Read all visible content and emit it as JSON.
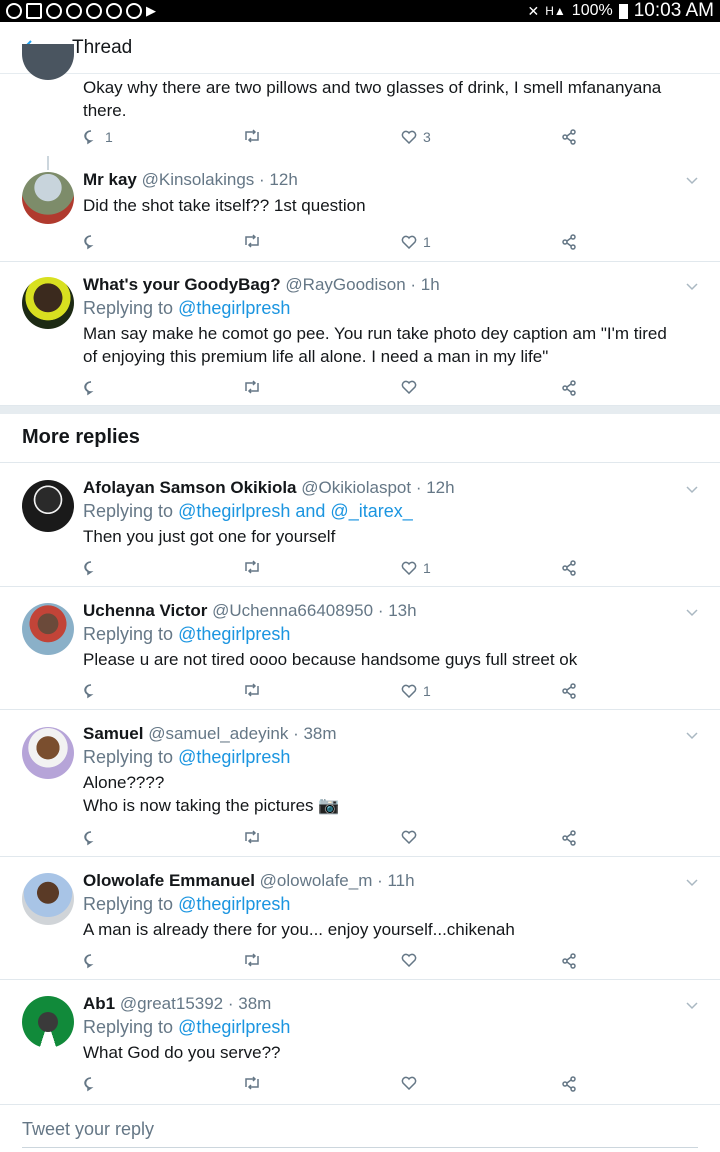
{
  "status_bar": {
    "battery": "100%",
    "time": "10:03 AM"
  },
  "header": {
    "back_icon": "arrow-left-icon",
    "title": "Thread"
  },
  "partial_tweet": {
    "text": "Okay why there are two pillows and two glasses of drink, I smell mfananyana there.",
    "replies": "1",
    "likes": "3"
  },
  "tweets": [
    {
      "name": "Mr kay",
      "handle": "@Kinsolakings",
      "time": "· 12h",
      "reply_prefix": "",
      "reply_to": "",
      "text": "Did the shot take itself?? 1st question",
      "replies": "",
      "likes": "1"
    },
    {
      "name": "What's your GoodyBag?",
      "handle": "@RayGoodison",
      "time": "· 1h",
      "reply_prefix": "Replying to",
      "reply_to": "@thegirlpresh",
      "text": "Man say make he comot go pee. You run take photo dey caption am \"I'm tired of enjoying this premium life all alone. I need a man in my life\"",
      "replies": "",
      "likes": ""
    }
  ],
  "more_replies": {
    "title": "More replies",
    "tweets": [
      {
        "name": "Afolayan Samson Okikiola",
        "handle": "@Okikiolaspot",
        "time": "· 12h",
        "reply_prefix": "Replying to",
        "reply_to": "@thegirlpresh and @_itarex_",
        "text": "Then you just got one for yourself",
        "replies": "",
        "likes": "1"
      },
      {
        "name": "Uchenna Victor",
        "handle": "@Uchenna66408950",
        "time": "· 13h",
        "reply_prefix": "Replying to",
        "reply_to": "@thegirlpresh",
        "text": "Please u are not tired oooo because handsome guys full street ok",
        "replies": "",
        "likes": "1"
      },
      {
        "name": "Samuel",
        "handle": "@samuel_adeyink",
        "time": "· 38m",
        "reply_prefix": "Replying to",
        "reply_to": "@thegirlpresh",
        "text": "Alone????\nWho is now taking the pictures 📷",
        "replies": "",
        "likes": ""
      },
      {
        "name": "Olowolafe Emmanuel",
        "handle": "@olowolafe_m",
        "time": "· 11h",
        "reply_prefix": "Replying to",
        "reply_to": "@thegirlpresh",
        "text": "A man is already there for you... enjoy yourself...chikenah",
        "replies": "",
        "likes": ""
      },
      {
        "name": "Ab1",
        "handle": "@great15392",
        "time": "· 38m",
        "reply_prefix": "Replying to",
        "reply_to": "@thegirlpresh",
        "text": "What God do you serve??",
        "replies": "",
        "likes": ""
      }
    ]
  },
  "compose": {
    "placeholder": "Tweet your reply"
  },
  "colors": {
    "accent": "#1da1f2",
    "mention": "#1b95e0",
    "secondary_text": "#657786"
  }
}
